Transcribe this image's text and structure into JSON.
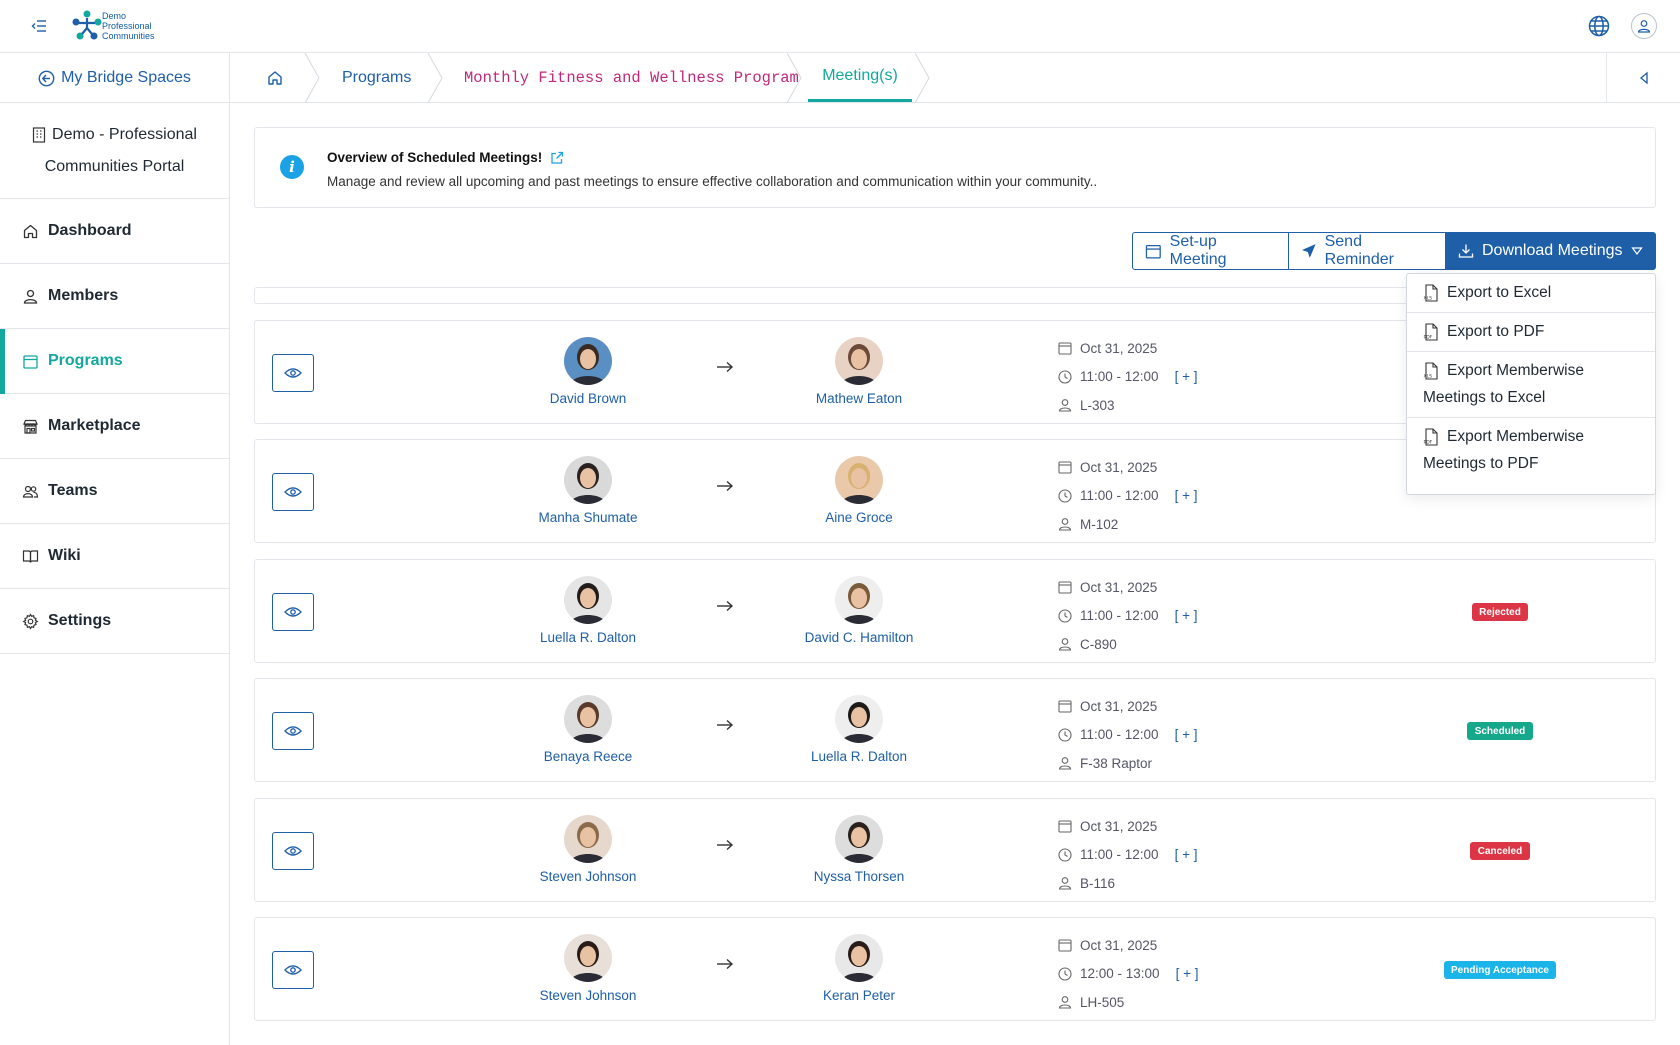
{
  "header": {
    "logo_text": [
      "Demo",
      "Professional",
      "Communities"
    ]
  },
  "breadcrumb": {
    "back_label": "My Bridge Spaces",
    "items": [
      "Programs",
      "Monthly Fitness and Wellness Program",
      "Meeting(s)"
    ]
  },
  "sidebar": {
    "portal_line1": "Demo - Professional",
    "portal_line2": "Communities Portal",
    "items": [
      {
        "label": "Dashboard",
        "icon": "home-icon"
      },
      {
        "label": "Members",
        "icon": "user-icon"
      },
      {
        "label": "Programs",
        "icon": "calendar-icon",
        "active": true
      },
      {
        "label": "Marketplace",
        "icon": "store-icon"
      },
      {
        "label": "Teams",
        "icon": "team-icon"
      },
      {
        "label": "Wiki",
        "icon": "book-icon"
      },
      {
        "label": "Settings",
        "icon": "gear-icon"
      }
    ]
  },
  "info": {
    "title": "Overview of Scheduled Meetings!",
    "description": "Manage and review all upcoming and past meetings to ensure effective collaboration and communication within your community.."
  },
  "actions": {
    "setup": "Set-up Meeting",
    "reminder": "Send Reminder",
    "download": "Download Meetings"
  },
  "download_menu": [
    {
      "line1": "Export to Excel",
      "line2": "",
      "icon": "xls-file-icon"
    },
    {
      "line1": "Export to PDF",
      "line2": "",
      "icon": "pdf-file-icon"
    },
    {
      "line1": "Export Memberwise",
      "line2": "Meetings to Excel",
      "icon": "xls-file-icon"
    },
    {
      "line1": "Export Memberwise",
      "line2": "Meetings to PDF",
      "icon": "pdf-file-icon"
    }
  ],
  "meetings": [
    {
      "host": "David Brown",
      "guest": "Mathew Eaton",
      "date": "Oct 31, 2025",
      "time": "11:00 - 12:00",
      "plus": "[ + ]",
      "room": "L-303",
      "status": ""
    },
    {
      "host": "Manha Shumate",
      "guest": "Aine Groce",
      "date": "Oct 31, 2025",
      "time": "11:00 - 12:00",
      "plus": "[ + ]",
      "room": "M-102",
      "status": ""
    },
    {
      "host": "Luella R. Dalton",
      "guest": "David C. Hamilton",
      "date": "Oct 31, 2025",
      "time": "11:00 - 12:00",
      "plus": "[ + ]",
      "room": "C-890",
      "status": "Rejected"
    },
    {
      "host": "Benaya Reece",
      "guest": "Luella R. Dalton",
      "date": "Oct 31, 2025",
      "time": "11:00 - 12:00",
      "plus": "[ + ]",
      "room": "F-38 Raptor",
      "status": "Scheduled"
    },
    {
      "host": "Steven Johnson",
      "guest": "Nyssa Thorsen",
      "date": "Oct 31, 2025",
      "time": "11:00 - 12:00",
      "plus": "[ + ]",
      "room": "B-116",
      "status": "Canceled"
    },
    {
      "host": "Steven Johnson",
      "guest": "Keran Peter",
      "date": "Oct 31, 2025",
      "time": "12:00 - 13:00",
      "plus": "[ + ]",
      "room": "LH-505",
      "status": "Pending Acceptance"
    }
  ],
  "colors": {
    "primary": "#1e5fa8",
    "accent": "#13a89e",
    "rejected": "#dc3545",
    "scheduled": "#15a88a",
    "canceled": "#dc3545",
    "pending": "#1ab4e8"
  }
}
